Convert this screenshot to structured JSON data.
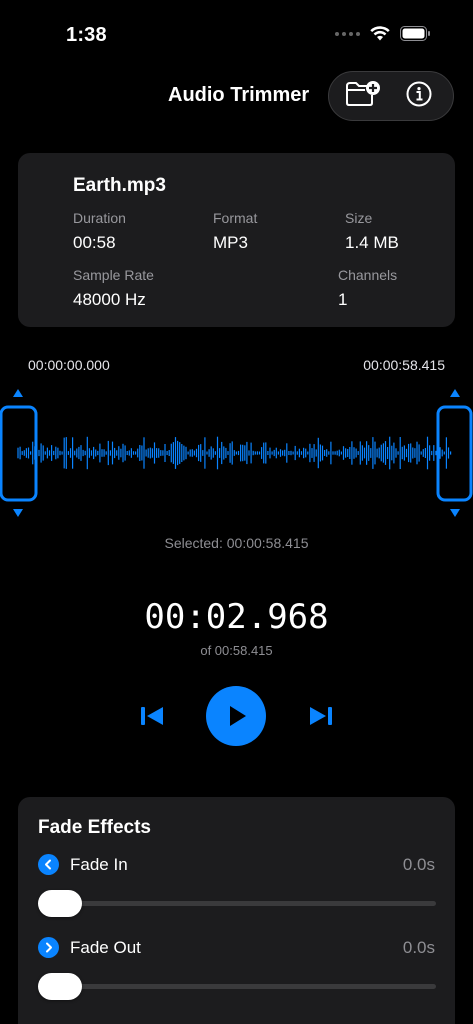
{
  "status": {
    "time": "1:38"
  },
  "header": {
    "title": "Audio Trimmer",
    "icons": [
      "folder-add-icon",
      "info-icon"
    ]
  },
  "file": {
    "name": "Earth.mp3",
    "duration_label": "Duration",
    "duration": "00:58",
    "format_label": "Format",
    "format": "MP3",
    "size_label": "Size",
    "size": "1.4 MB",
    "sample_rate_label": "Sample Rate",
    "sample_rate": "48000 Hz",
    "channels_label": "Channels",
    "channels": "1"
  },
  "timeline": {
    "start": "00:00:00.000",
    "end": "00:00:58.415",
    "selected": "Selected: 00:00:58.415"
  },
  "playback": {
    "current": "00:02.968",
    "total": "of 00:58.415",
    "playing": false
  },
  "fade": {
    "title": "Fade Effects",
    "fade_in": {
      "label": "Fade In",
      "value": "0.0s",
      "level": 0
    },
    "fade_out": {
      "label": "Fade Out",
      "value": "0.0s",
      "level": 0
    }
  },
  "colors": {
    "accent": "#0a84ff",
    "card": "#1c1c1e",
    "background": "#000000"
  }
}
